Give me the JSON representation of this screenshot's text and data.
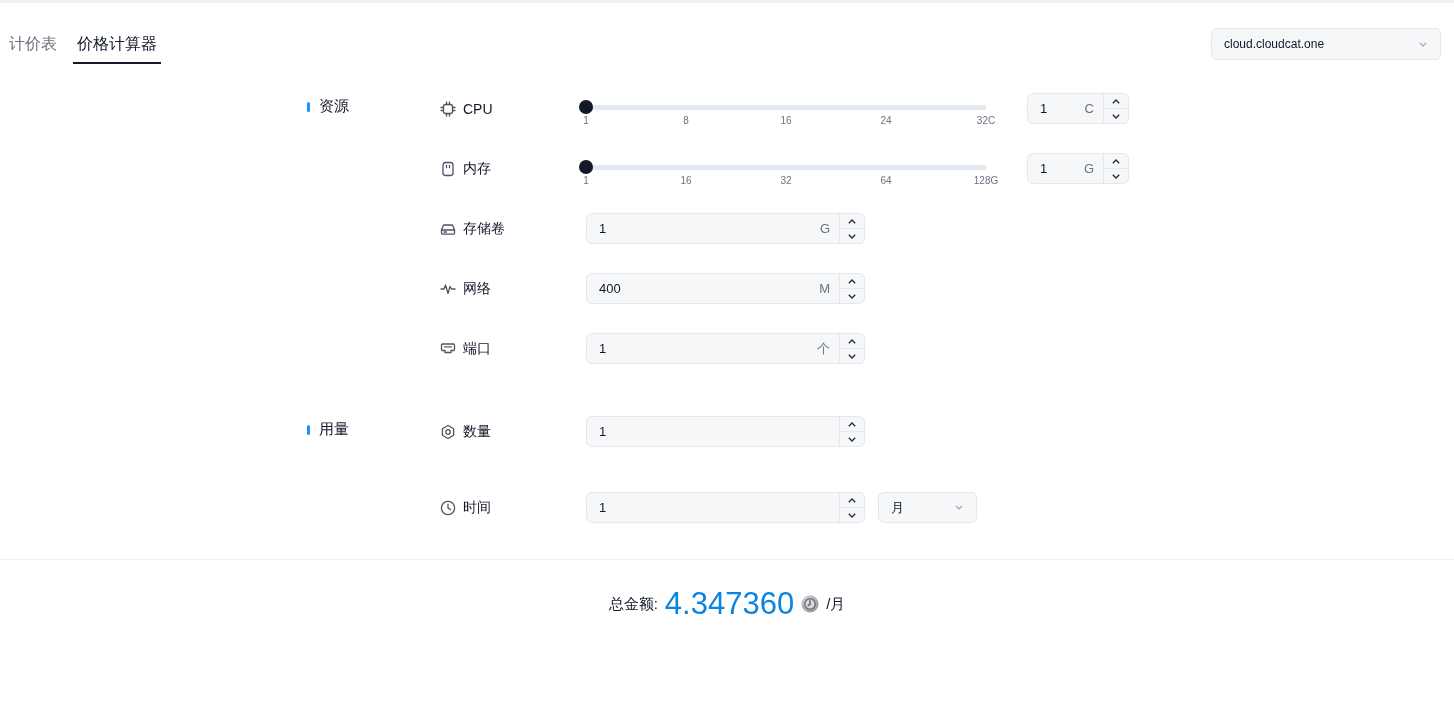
{
  "tabs": [
    {
      "label": "计价表",
      "selected": false
    },
    {
      "label": "价格计算器",
      "selected": true
    }
  ],
  "server_select": {
    "value": "cloud.cloudcat.one"
  },
  "sections": [
    {
      "title": "资源",
      "fields": [
        {
          "kind": "slider",
          "label": "CPU",
          "level": 0,
          "ticks": [
            "1",
            "8",
            "16",
            "24",
            "32C"
          ],
          "value": "1",
          "unit": "C"
        },
        {
          "kind": "slider",
          "label": "内存",
          "level": 0,
          "ticks": [
            "1",
            "16",
            "32",
            "64",
            "128G"
          ],
          "value": "1",
          "unit": "G"
        },
        {
          "kind": "number",
          "label": "存储卷",
          "value": "1",
          "unit": "G"
        },
        {
          "kind": "number",
          "label": "网络",
          "value": "400",
          "unit": "M"
        },
        {
          "kind": "number",
          "label": "端口",
          "value": "1",
          "unit": "个"
        }
      ]
    },
    {
      "title": "用量",
      "fields": [
        {
          "kind": "number",
          "label": "数量",
          "value": "1"
        },
        {
          "kind": "number",
          "label": "时间",
          "value": "1",
          "select": {
            "value": "月"
          }
        }
      ]
    }
  ],
  "total": {
    "label": "总金额:",
    "amount": "4.347360",
    "period": "/月"
  }
}
